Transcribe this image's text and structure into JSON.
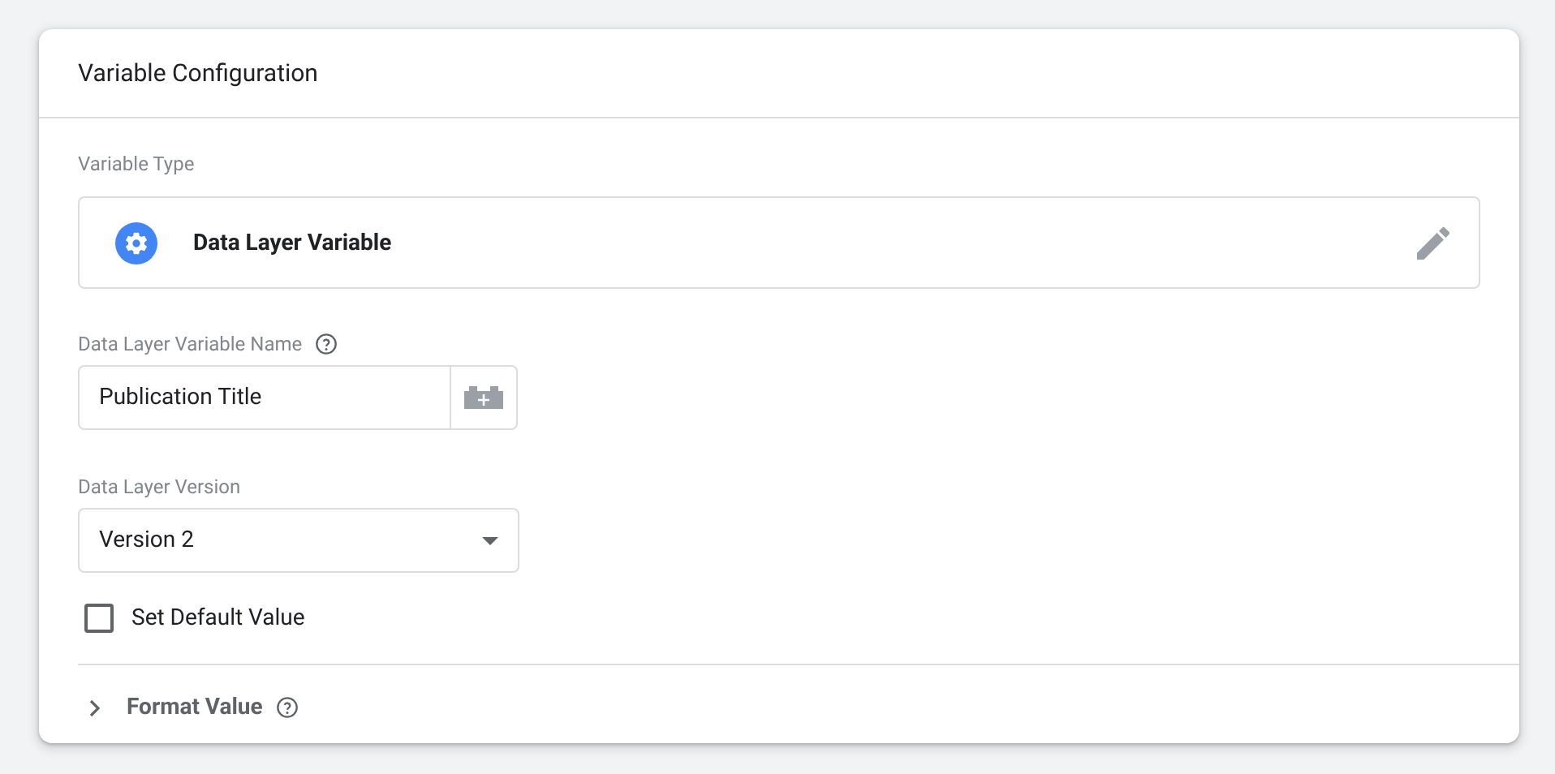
{
  "card": {
    "title": "Variable Configuration"
  },
  "variable_type": {
    "label": "Variable Type",
    "value": "Data Layer Variable"
  },
  "name_field": {
    "label": "Data Layer Variable Name",
    "value": "Publication Title"
  },
  "version_field": {
    "label": "Data Layer Version",
    "value": "Version 2"
  },
  "default_value": {
    "label": "Set Default Value",
    "checked": false
  },
  "format_value": {
    "label": "Format Value",
    "expanded": false
  }
}
